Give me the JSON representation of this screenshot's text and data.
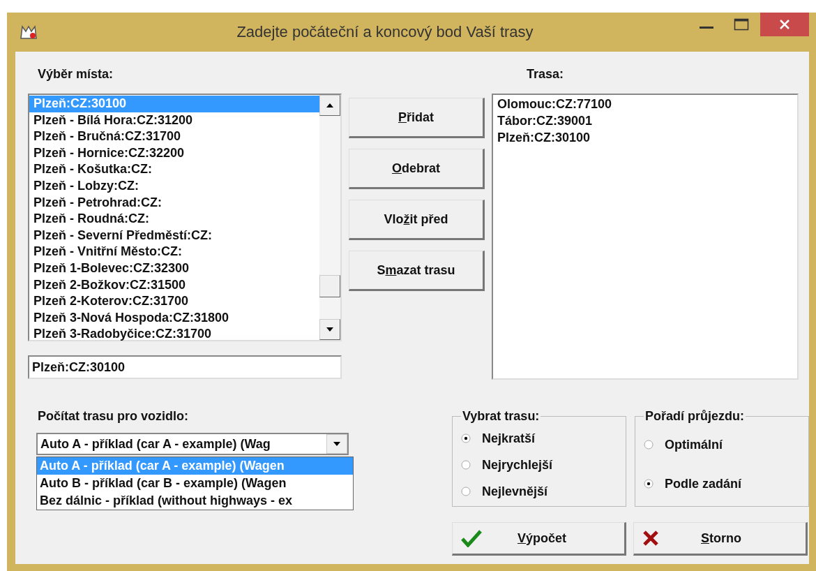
{
  "window": {
    "title": "Zadejte počáteční a koncový bod Vaší trasy"
  },
  "place_picker": {
    "label": "Výběr místa:",
    "value": "Plzeň:CZ:30100",
    "items": [
      {
        "text": "Plzeň:CZ:30100",
        "selected": true
      },
      {
        "text": "Plzeň - Bílá Hora:CZ:31200",
        "selected": false
      },
      {
        "text": "Plzeň - Bručná:CZ:31700",
        "selected": false
      },
      {
        "text": "Plzeň - Hornice:CZ:32200",
        "selected": false
      },
      {
        "text": "Plzeň - Košutka:CZ:",
        "selected": false
      },
      {
        "text": "Plzeň - Lobzy:CZ:",
        "selected": false
      },
      {
        "text": "Plzeň - Petrohrad:CZ:",
        "selected": false
      },
      {
        "text": "Plzeň - Roudná:CZ:",
        "selected": false
      },
      {
        "text": "Plzeň - Severní Předměstí:CZ:",
        "selected": false
      },
      {
        "text": "Plzeň - Vnitřní Město:CZ:",
        "selected": false
      },
      {
        "text": "Plzeň 1-Bolevec:CZ:32300",
        "selected": false
      },
      {
        "text": "Plzeň 2-Božkov:CZ:31500",
        "selected": false
      },
      {
        "text": "Plzeň 2-Koterov:CZ:31700",
        "selected": false
      },
      {
        "text": "Plzeň 3-Nová Hospoda:CZ:31800",
        "selected": false
      },
      {
        "text": "Plzeň 3-Radobyčice:CZ:31700",
        "selected": false
      }
    ]
  },
  "actions": [
    {
      "key": "P",
      "after": "řidat"
    },
    {
      "key": "O",
      "after": "debrat"
    },
    {
      "before": "Vlo",
      "key": "ž",
      "after": "it před"
    },
    {
      "before": "S",
      "key": "m",
      "after": "azat trasu"
    }
  ],
  "route": {
    "label": "Trasa:",
    "items": [
      "Olomouc:CZ:77100",
      "Tábor:CZ:39001",
      "Plzeň:CZ:30100"
    ]
  },
  "vehicle": {
    "label": "Počítat trasu pro vozidlo:",
    "value": "Auto A - příklad (car A - example) (Wag",
    "options": [
      {
        "text": "Auto A - příklad (car A - example) (Wagen",
        "selected": true
      },
      {
        "text": "Auto B - příklad (car B - example) (Wagen",
        "selected": false
      },
      {
        "text": "Bez dálnic - příklad (without highways - ex",
        "selected": false
      }
    ]
  },
  "route_type": {
    "title": "Vybrat trasu:",
    "options": [
      {
        "label": "Nejkratší",
        "selected": true
      },
      {
        "label": "Nejrychlejší",
        "selected": false
      },
      {
        "label": "Nejlevnější",
        "selected": false
      }
    ]
  },
  "order": {
    "title": "Pořadí průjezdu:",
    "options": [
      {
        "label": "Optimální",
        "selected": false
      },
      {
        "label": "Podle zadání",
        "selected": true
      }
    ]
  },
  "buttons": [
    {
      "kind": "ok",
      "key": "V",
      "after": "ýpočet"
    },
    {
      "kind": "cancel",
      "key": "S",
      "after": "torno"
    }
  ]
}
